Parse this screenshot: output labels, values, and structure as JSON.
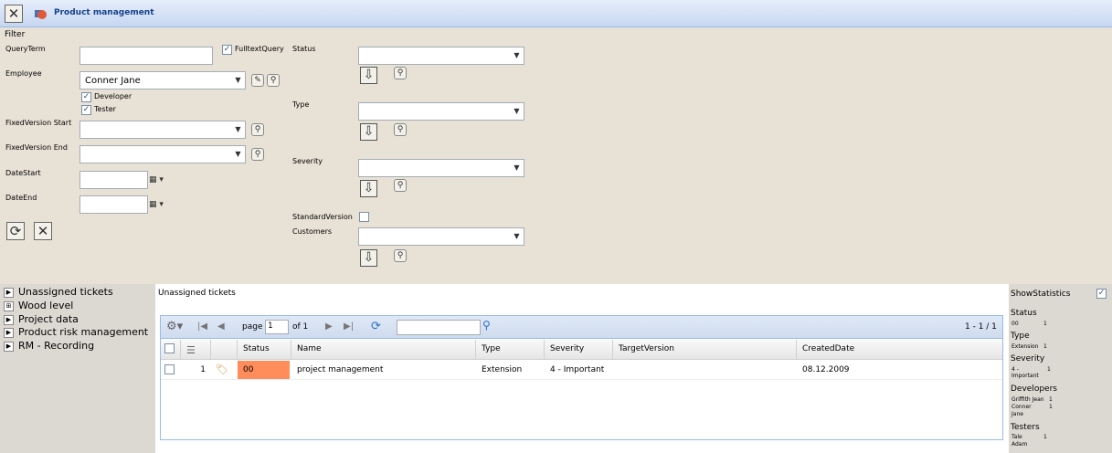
{
  "window": {
    "title": "Product management"
  },
  "filter": {
    "heading": "Filter",
    "query_term_label": "QueryTerm",
    "query_term_value": "",
    "fulltext_query_label": "FulltextQuery",
    "fulltext_query_checked": true,
    "employee_label": "Employee",
    "employee_value": "Conner Jane",
    "developer_label": "Developer",
    "developer_checked": true,
    "tester_label": "Tester",
    "tester_checked": true,
    "fixed_version_start_label": "FixedVersion Start",
    "fixed_version_end_label": "FixedVersion End",
    "date_start_label": "DateStart",
    "date_end_label": "DateEnd",
    "status_label": "Status",
    "type_label": "Type",
    "severity_label": "Severity",
    "standard_version_label": "StandardVersion",
    "standard_version_checked": false,
    "customers_label": "Customers"
  },
  "tree": {
    "items": [
      {
        "label": "Unassigned tickets"
      },
      {
        "label": "Wood level"
      },
      {
        "label": "Project data"
      },
      {
        "label": "Product risk management"
      },
      {
        "label": "RM - Recording"
      }
    ]
  },
  "grid": {
    "title": "Unassigned tickets",
    "toolbar": {
      "page_label": "page",
      "page_value": "1",
      "of_label": "of 1",
      "range_label": "1 - 1 / 1",
      "search_value": ""
    },
    "columns": [
      "Status",
      "Name",
      "Type",
      "Severity",
      "TargetVersion",
      "CreatedDate"
    ],
    "rows": [
      {
        "num": "1",
        "status": "00",
        "name": "project management",
        "type": "Extension",
        "severity": "4 - Important",
        "target_version": "",
        "created": "08.12.2009"
      }
    ],
    "status_color": "#ff8c5a"
  },
  "stats": {
    "show_label": "ShowStatistics",
    "show_checked": true,
    "status_heading": "Status",
    "status_name": "00",
    "status_count": "1",
    "type_heading": "Type",
    "type_name": "Extension",
    "type_count": "1",
    "severity_heading": "Severity",
    "severity_name": "4 - Important",
    "severity_count": "1",
    "developers_heading": "Developers",
    "dev1_name": "Griffith Jean",
    "dev1_count": "1",
    "dev2_name": "Conner Jane",
    "dev2_count": "1",
    "testers_heading": "Testers",
    "tester1_name": "Tale Adam",
    "tester1_count": "1"
  },
  "colors": {
    "filter_bg": "#e8e2d6",
    "side_bg": "#dcd9d2",
    "title_text": "#15428b"
  }
}
